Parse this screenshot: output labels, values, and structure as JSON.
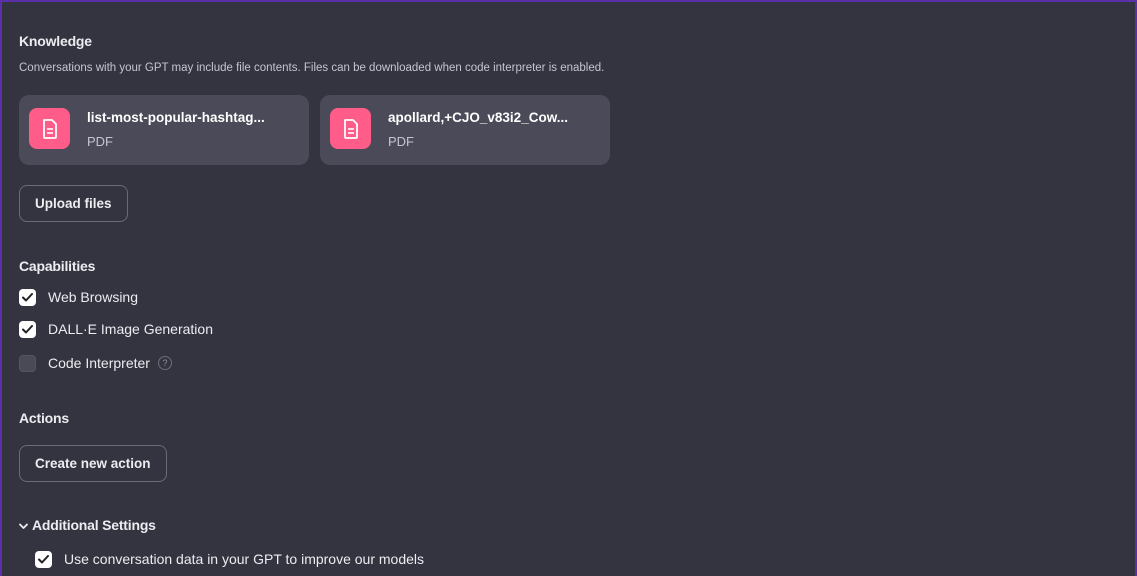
{
  "knowledge": {
    "title": "Knowledge",
    "description": "Conversations with your GPT may include file contents. Files can be downloaded when code interpreter is enabled.",
    "files": [
      {
        "name": "list-most-popular-hashtag...",
        "type": "PDF",
        "icon": "document-icon"
      },
      {
        "name": "apollard,+CJO_v83i2_Cow...",
        "type": "PDF",
        "icon": "document-icon"
      }
    ],
    "upload_label": "Upload files"
  },
  "capabilities": {
    "title": "Capabilities",
    "items": [
      {
        "label": "Web Browsing",
        "checked": true
      },
      {
        "label": "DALL·E Image Generation",
        "checked": true
      },
      {
        "label": "Code Interpreter",
        "checked": false,
        "help": "?"
      }
    ]
  },
  "actions": {
    "title": "Actions",
    "create_label": "Create new action"
  },
  "additional_settings": {
    "title": "Additional Settings",
    "expanded": true,
    "items": [
      {
        "label": "Use conversation data in your GPT to improve our models",
        "checked": true
      }
    ]
  },
  "colors": {
    "background": "#343440",
    "file_icon": "#ff5c8a",
    "card": "#4a4a58",
    "frame": "#5b2fa8"
  }
}
